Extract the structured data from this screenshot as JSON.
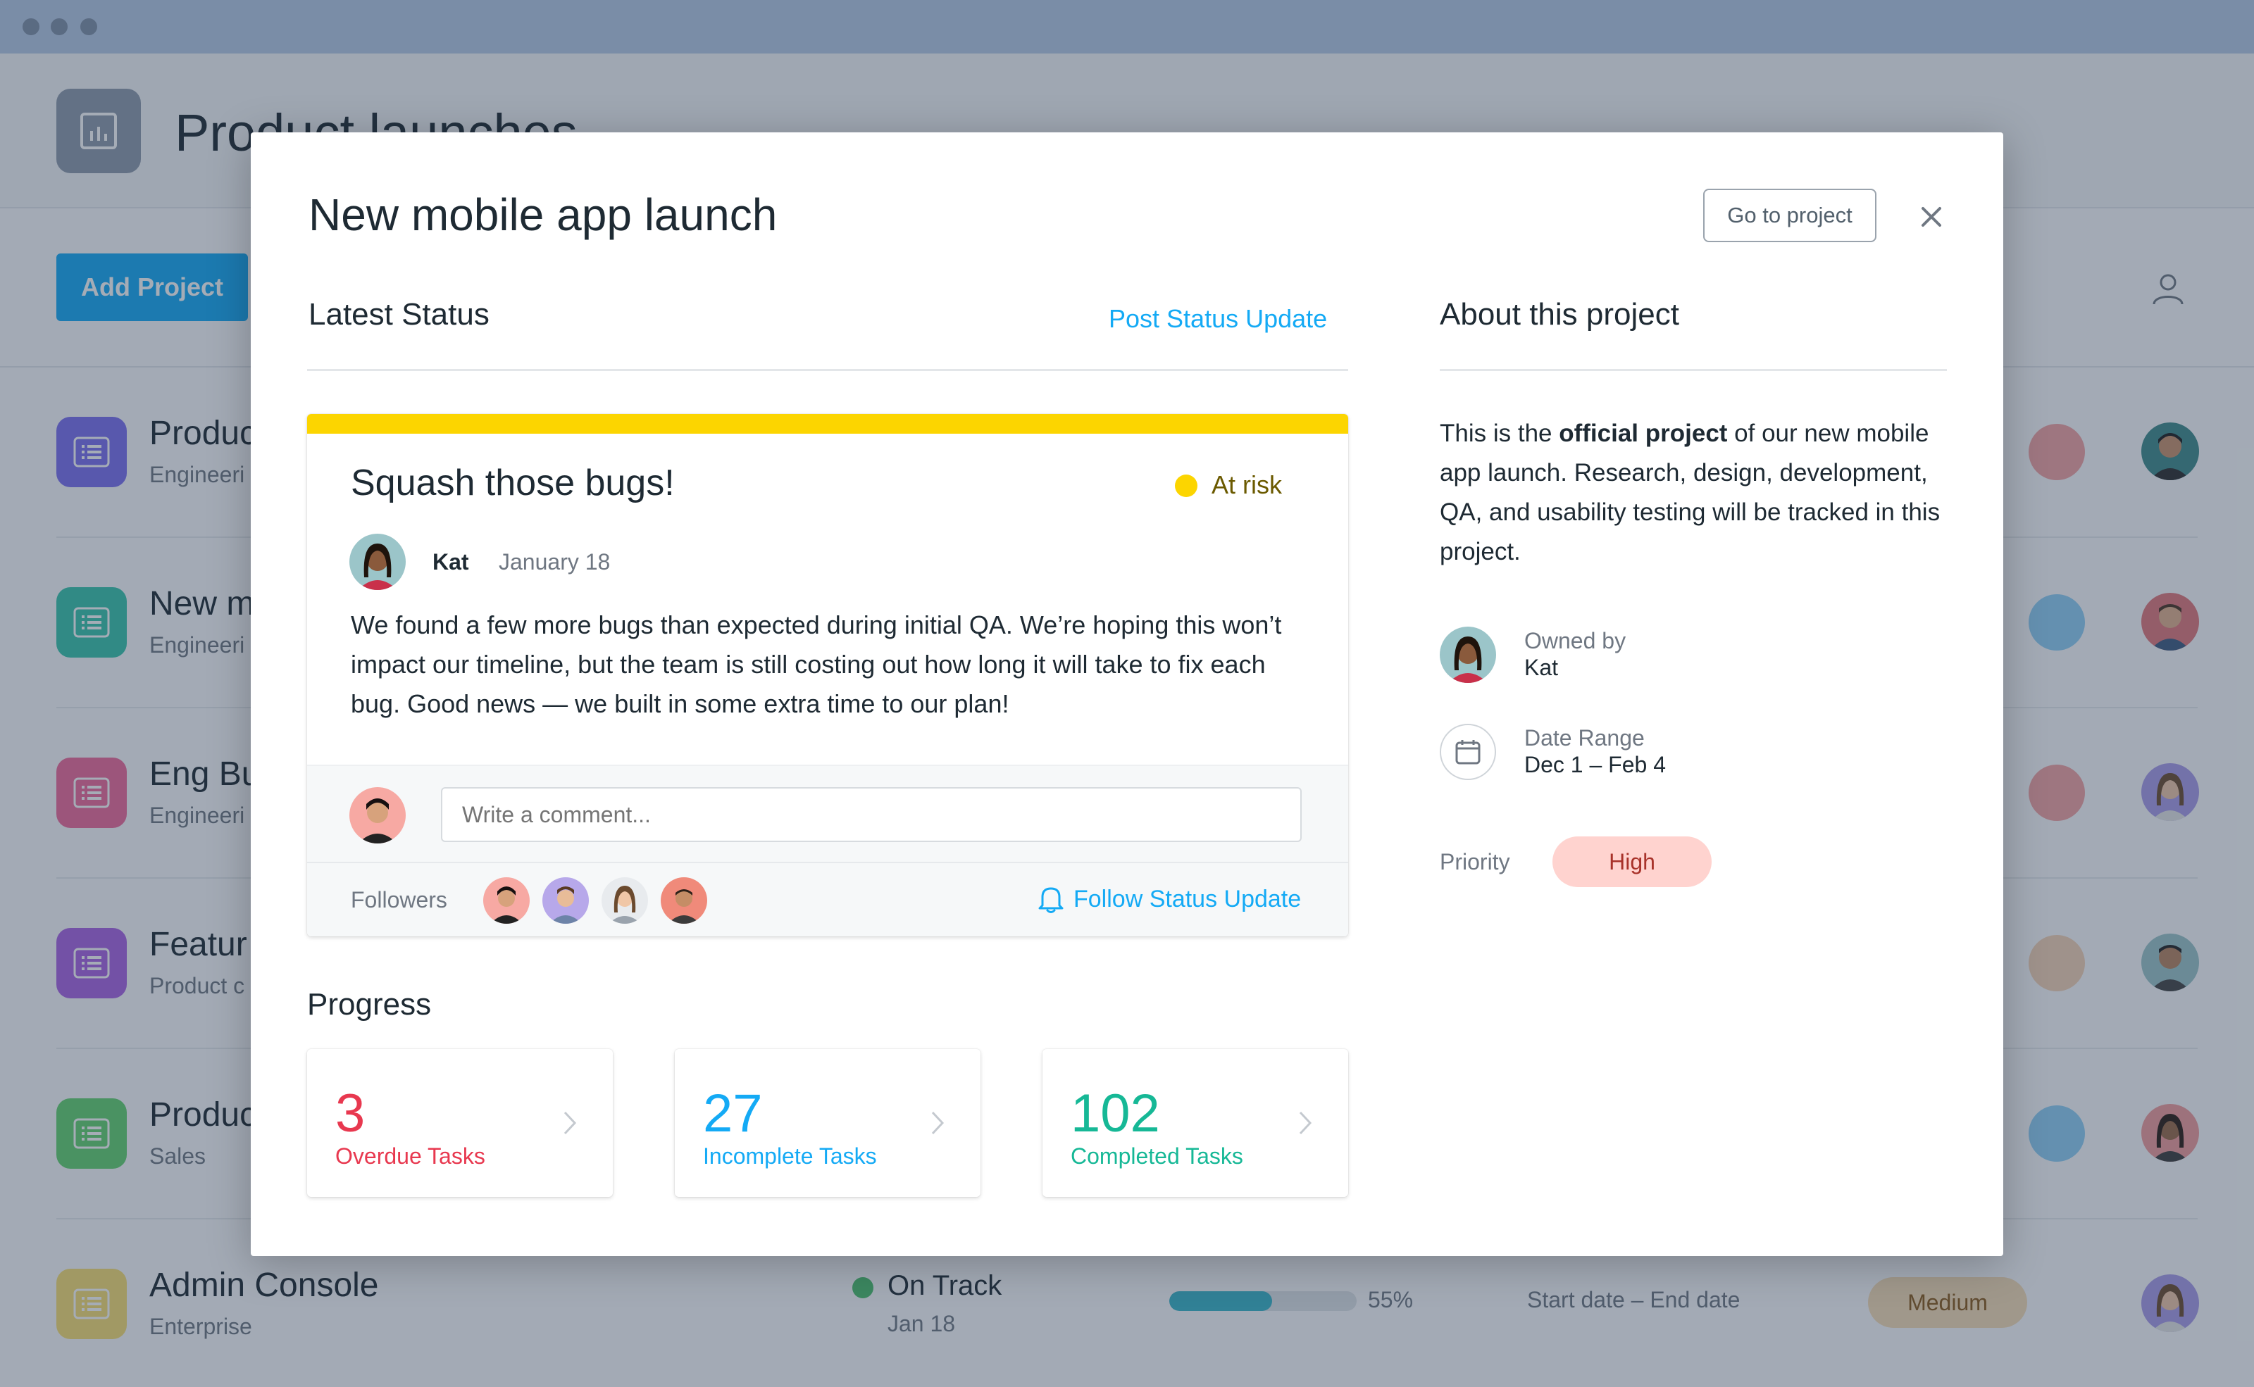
{
  "app": {
    "title": "Product launches",
    "add_project_label": "Add Project"
  },
  "rows": [
    {
      "name": "Produc",
      "team": "Engineeri",
      "icon_color": "#7a6ff0"
    },
    {
      "name": "New m",
      "team": "Engineeri",
      "icon_color": "#37c5ab"
    },
    {
      "name": "Eng Bu",
      "team": "Engineeri",
      "icon_color": "#f06a99"
    },
    {
      "name": "Featur",
      "team": "Product c",
      "icon_color": "#aa62e3"
    },
    {
      "name": "Produc",
      "team": "Sales",
      "icon_color": "#62d26f"
    }
  ],
  "last_row": {
    "name": "Admin Console",
    "team": "Enterprise",
    "status": "On Track",
    "status_date": "Jan 18",
    "progress_percent": 55,
    "progress_label": "55%",
    "date_range": "Start date – End date",
    "priority": "Medium"
  },
  "modal": {
    "title": "New mobile app launch",
    "goto_label": "Go to project",
    "latest_status_heading": "Latest Status",
    "post_status_label": "Post Status Update",
    "about_heading": "About this project",
    "status": {
      "title": "Squash those bugs!",
      "risk_label": "At risk",
      "risk_color": "#fcd500",
      "author": "Kat",
      "date": "January 18",
      "body": "We found a few more bugs than expected during initial QA. We’re hoping this won’t impact our timeline, but the team is still costing out how long it will take to fix each bug. Good news — we built in some extra time to our plan!",
      "comment_placeholder": "Write a comment...",
      "followers_label": "Followers",
      "follow_label": "Follow Status Update"
    },
    "progress": {
      "heading": "Progress",
      "overdue": {
        "value": "3",
        "label": "Overdue Tasks",
        "color": "#e8384f"
      },
      "incomplete": {
        "value": "27",
        "label": "Incomplete Tasks",
        "color": "#14aaf5"
      },
      "completed": {
        "value": "102",
        "label": "Completed Tasks",
        "color": "#16b896"
      }
    },
    "about": {
      "text_before": "This is the ",
      "text_bold": "official project",
      "text_after": " of our new mobile app launch. Research, design, development, QA, and usability testing will be tracked in this project.",
      "owned_by_label": "Owned by",
      "owner": "Kat",
      "date_range_label": "Date Range",
      "date_range": "Dec 1 – Feb 4",
      "priority_label": "Priority",
      "priority": "High"
    }
  },
  "colors": {
    "accent": "#14aaf5",
    "at_risk": "#fcd500",
    "on_track": "#4bbf6b",
    "priority_high_bg": "#ffd3cf",
    "priority_medium_bg": "#f7dcb6"
  }
}
